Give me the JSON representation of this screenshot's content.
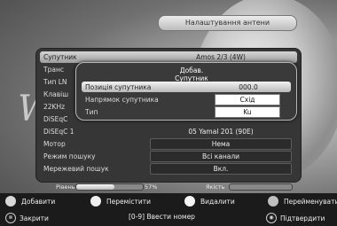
{
  "header": {
    "title": "Налаштування антени"
  },
  "panel": {
    "rows": [
      {
        "label": "Супутник",
        "value": "Amos 2/3 (4W)"
      },
      {
        "label": "Транс",
        "value": ""
      },
      {
        "label": "Тип LN",
        "value": ""
      },
      {
        "label": "Клавіш",
        "value": ""
      },
      {
        "label": "22KHz",
        "value": ""
      },
      {
        "label": "DiSEqC",
        "value": ""
      },
      {
        "label": "DiSEqC 1",
        "value": "05 Yamal 201 (90E)"
      },
      {
        "label": "Мотор",
        "value": "Нема"
      },
      {
        "label": "Режим пошуку",
        "value": "Всі канали"
      },
      {
        "label": "Мережевий пошук",
        "value": "Вкл."
      }
    ]
  },
  "dialog": {
    "title": "Добав. Супутник",
    "rows": [
      {
        "label": "Позиція супутника",
        "value": "000.0"
      },
      {
        "label": "Напрямок супутника",
        "value": "Схід"
      },
      {
        "label": "Тип",
        "value": "Ku"
      }
    ]
  },
  "signal": {
    "strength_label": "Рівень",
    "quality_label": "Якість",
    "strength_value": "57%",
    "strength_fraction": 0.57,
    "quality_fraction": 0.0
  },
  "footer": {
    "buttons": [
      {
        "label": "Добавити",
        "color": "#d9d9d9"
      },
      {
        "label": "Перемістити",
        "color": "#efefef"
      },
      {
        "label": "Видалити",
        "color": "#f5f5f5"
      },
      {
        "label": "Перейменувати",
        "color": "#bfbfbf"
      }
    ],
    "close_label": "Закрити",
    "enter_number_label": "[0-9] Ввести номер",
    "confirm_label": "Підтвердити"
  }
}
